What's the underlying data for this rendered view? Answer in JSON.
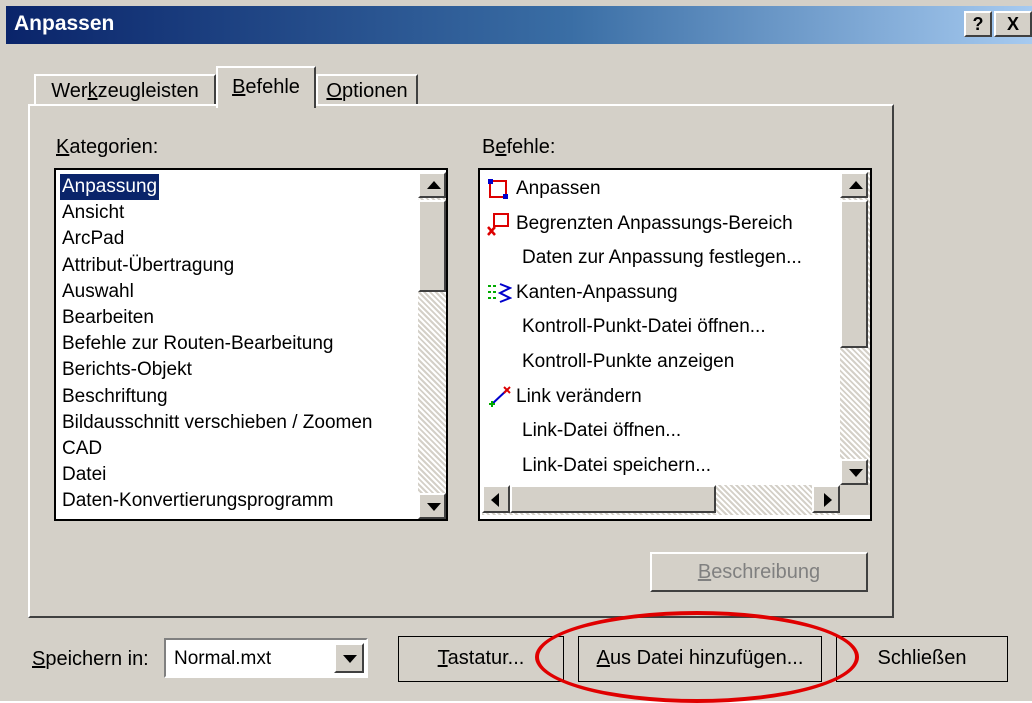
{
  "window": {
    "title": "Anpassen",
    "help_button": "?",
    "close_button": "X"
  },
  "tabs": [
    {
      "label": "Werkzeugleisten",
      "pre": "Wer",
      "key": "k",
      "post": "zeugleisten"
    },
    {
      "label": "Befehle",
      "pre": "",
      "key": "B",
      "post": "efehle"
    },
    {
      "label": "Optionen",
      "pre": "",
      "key": "O",
      "post": "ptionen"
    }
  ],
  "categories": {
    "label_key": "K",
    "label_rest": "ategorien:",
    "items": [
      "Anpassung",
      "Ansicht",
      "ArcPad",
      "Attribut-Übertragung",
      "Auswahl",
      "Bearbeiten",
      "Befehle zur Routen-Bearbeitung",
      "Berichts-Objekt",
      "Beschriftung",
      "Bildausschnitt verschieben / Zoomen",
      "CAD",
      "Datei",
      "Daten-Konvertierungsprogramm"
    ],
    "selected_index": 0
  },
  "commands": {
    "label_pre": "B",
    "label_key": "e",
    "label_rest": "fehle:",
    "items": [
      {
        "label": "Anpassen",
        "icon": "adjust-icon"
      },
      {
        "label": "Begrenzten Anpassungs-Bereich",
        "icon": "limited-adjust-icon"
      },
      {
        "label": "Daten zur Anpassung festlegen...",
        "icon": ""
      },
      {
        "label": "Kanten-Anpassung",
        "icon": "edge-match-icon"
      },
      {
        "label": "Kontroll-Punkt-Datei öffnen...",
        "icon": ""
      },
      {
        "label": "Kontroll-Punkte anzeigen",
        "icon": ""
      },
      {
        "label": "Link verändern",
        "icon": "modify-link-icon"
      },
      {
        "label": "Link-Datei öffnen...",
        "icon": ""
      },
      {
        "label": "Link-Datei speichern...",
        "icon": ""
      }
    ]
  },
  "description_button": {
    "key": "B",
    "rest": "eschreibung"
  },
  "footer": {
    "save_in_key": "S",
    "save_in_rest": "peichern in:",
    "save_in_value": "Normal.mxt",
    "keyboard_key": "T",
    "keyboard_rest": "astatur...",
    "add_from_file_key": "A",
    "add_from_file_rest": "us Datei hinzufügen...",
    "close_label": "Schließen"
  },
  "colors": {
    "title_start": "#0a246a",
    "title_end": "#a6caf0",
    "selection": "#0a246a",
    "dialog_bg": "#d4d0c8",
    "highlight_circle": "#e00000"
  }
}
